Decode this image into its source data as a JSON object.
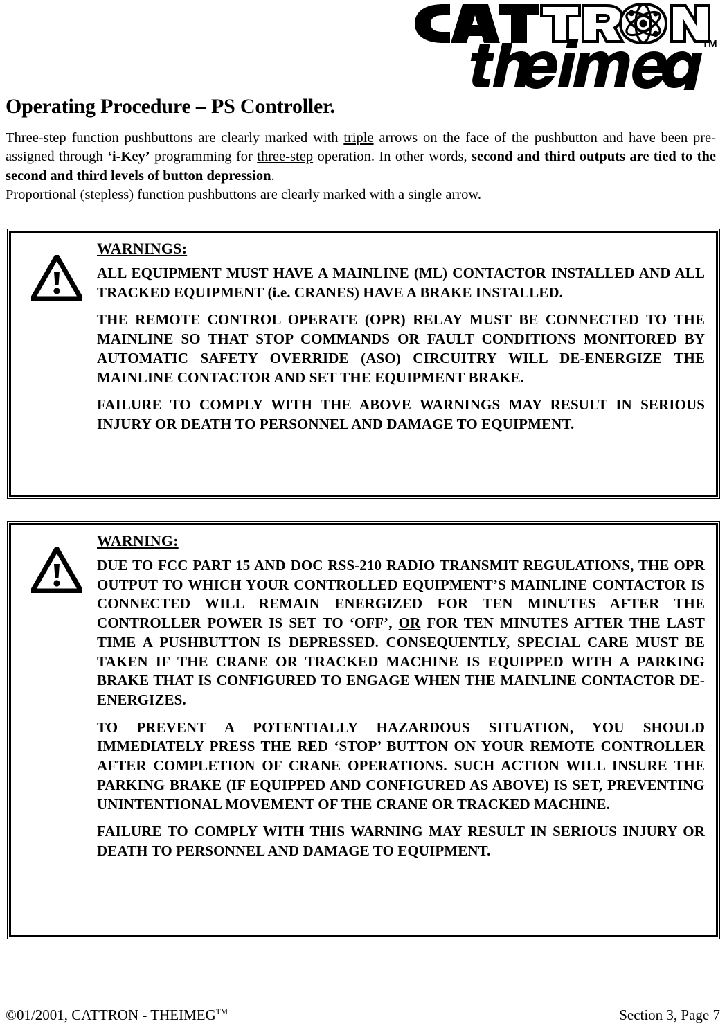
{
  "header": {
    "logo_primary": "CATTRON",
    "logo_secondary": "theimeg",
    "logo_tm": "TM",
    "logo_icon": "atom-icon"
  },
  "title": "Operating Procedure – PS Controller.",
  "intro": {
    "p1_seg1": "Three-step function pushbuttons are clearly marked with ",
    "p1_underline1": "triple",
    "p1_seg2": " arrows on the face of the pushbutton and have been pre-assigned through ",
    "p1_bold1": "‘i-Key’",
    "p1_seg3": " programming for ",
    "p1_underline2": "three-step",
    "p1_seg4": " operation.  In other words, ",
    "p1_bold2": "second and third outputs are tied to the second and third levels of button depression",
    "p1_seg5": ".",
    "p2": "Proportional (stepless) function pushbuttons are clearly marked with a single arrow."
  },
  "warning_box_1": {
    "icon": "warning-triangle-icon",
    "heading": "WARNINGS:",
    "paragraphs": [
      "ALL EQUIPMENT MUST HAVE A MAINLINE (ML) CONTACTOR INSTALLED AND ALL TRACKED EQUIPMENT (i.e. CRANES) HAVE A BRAKE INSTALLED.",
      "THE REMOTE CONTROL OPERATE (OPR) RELAY MUST BE CONNECTED TO THE MAINLINE SO THAT STOP COMMANDS OR FAULT CONDITIONS MONITORED BY AUTOMATIC SAFETY OVERRIDE (ASO) CIRCUITRY WILL DE-ENERGIZE THE MAINLINE CONTACTOR AND SET THE EQUIPMENT BRAKE.",
      "FAILURE TO COMPLY WITH THE ABOVE WARNINGS MAY RESULT IN SERIOUS INJURY OR DEATH TO PERSONNEL AND DAMAGE TO EQUIPMENT."
    ]
  },
  "warning_box_2": {
    "icon": "warning-triangle-icon",
    "heading": "WARNING:",
    "p1_seg1": "DUE TO FCC PART 15 AND DOC RSS-210 RADIO TRANSMIT REGULATIONS, THE OPR OUTPUT TO WHICH YOUR CONTROLLED EQUIPMENT’S MAINLINE CONTACTOR IS CONNECTED WILL REMAIN ENERGIZED FOR TEN MINUTES AFTER THE CONTROLLER POWER IS SET TO ‘OFF’, ",
    "p1_underline": "OR",
    "p1_seg2": " FOR TEN MINUTES AFTER THE LAST TIME A PUSHBUTTON IS DEPRESSED.  CONSEQUENTLY, SPECIAL CARE MUST BE TAKEN IF THE CRANE OR TRACKED MACHINE IS EQUIPPED WITH A PARKING BRAKE THAT IS CONFIGURED TO ENGAGE WHEN THE MAINLINE CONTACTOR DE-ENERGIZES.",
    "p2": "TO PREVENT A POTENTIALLY HAZARDOUS SITUATION, YOU SHOULD IMMEDIATELY PRESS THE RED ‘STOP’ BUTTON ON YOUR REMOTE CONTROLLER AFTER COMPLETION OF CRANE OPERATIONS.  SUCH ACTION WILL INSURE THE PARKING BRAKE (IF EQUIPPED AND CONFIGURED AS ABOVE) IS SET, PREVENTING UNINTENTIONAL MOVEMENT OF THE CRANE OR TRACKED MACHINE.",
    "p3": "FAILURE TO COMPLY WITH THIS WARNING MAY RESULT IN SERIOUS INJURY OR DEATH TO PERSONNEL AND DAMAGE TO EQUIPMENT."
  },
  "footer": {
    "copyright_symbol": "©",
    "left_text": "01/2001, CATTRON - THEIMEG",
    "left_tm": "TM",
    "right_text": "Section 3, Page 7"
  },
  "colors": {
    "ink": "#000000",
    "page": "#ffffff"
  }
}
